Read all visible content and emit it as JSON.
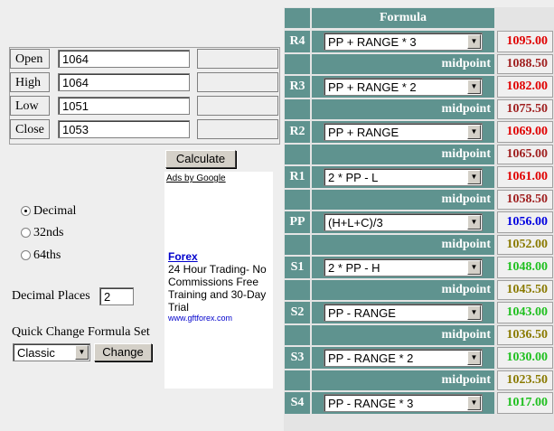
{
  "ohlc": [
    {
      "label": "Open",
      "value": "1064"
    },
    {
      "label": "High",
      "value": "1064"
    },
    {
      "label": "Low",
      "value": "1051"
    },
    {
      "label": "Close",
      "value": "1053"
    }
  ],
  "calculate_label": "Calculate",
  "ad": {
    "ads_by": "Ads by Google",
    "title": "Forex",
    "body": "24 Hour Trading- No Commissions Free Training and 30-Day Trial",
    "url": "www.gftforex.com"
  },
  "format_options": [
    {
      "label": "Decimal",
      "selected": true
    },
    {
      "label": "32nds",
      "selected": false
    },
    {
      "label": "64ths",
      "selected": false
    }
  ],
  "decimal_places": {
    "label": "Decimal Places",
    "value": "2"
  },
  "quick_change": {
    "label": "Quick Change Formula Set",
    "selected": "Classic",
    "button": "Change"
  },
  "formula_header": "Formula",
  "midpoint_label": "midpoint",
  "levels": [
    {
      "tag": "R4",
      "formula": "PP + RANGE * 3",
      "value": "1095.00",
      "color": "#e00000"
    },
    {
      "mid": "1088.50",
      "mid_color": "#a02020"
    },
    {
      "tag": "R3",
      "formula": "PP + RANGE * 2",
      "value": "1082.00",
      "color": "#e00000"
    },
    {
      "mid": "1075.50",
      "mid_color": "#a02020"
    },
    {
      "tag": "R2",
      "formula": "PP + RANGE",
      "value": "1069.00",
      "color": "#e00000"
    },
    {
      "mid": "1065.00",
      "mid_color": "#a02020"
    },
    {
      "tag": "R1",
      "formula": "2 * PP - L",
      "value": "1061.00",
      "color": "#e00000"
    },
    {
      "mid": "1058.50",
      "mid_color": "#a02020"
    },
    {
      "tag": "PP",
      "formula": "(H+L+C)/3",
      "value": "1056.00",
      "color": "#0000e0"
    },
    {
      "mid": "1052.00",
      "mid_color": "#8a7a00"
    },
    {
      "tag": "S1",
      "formula": "2 * PP - H",
      "value": "1048.00",
      "color": "#20c020"
    },
    {
      "mid": "1045.50",
      "mid_color": "#8a7a00"
    },
    {
      "tag": "S2",
      "formula": "PP - RANGE",
      "value": "1043.00",
      "color": "#20c020"
    },
    {
      "mid": "1036.50",
      "mid_color": "#8a7a00"
    },
    {
      "tag": "S3",
      "formula": "PP - RANGE * 2",
      "value": "1030.00",
      "color": "#20c020"
    },
    {
      "mid": "1023.50",
      "mid_color": "#8a7a00"
    },
    {
      "tag": "S4",
      "formula": "PP - RANGE * 3",
      "value": "1017.00",
      "color": "#20c020"
    }
  ]
}
